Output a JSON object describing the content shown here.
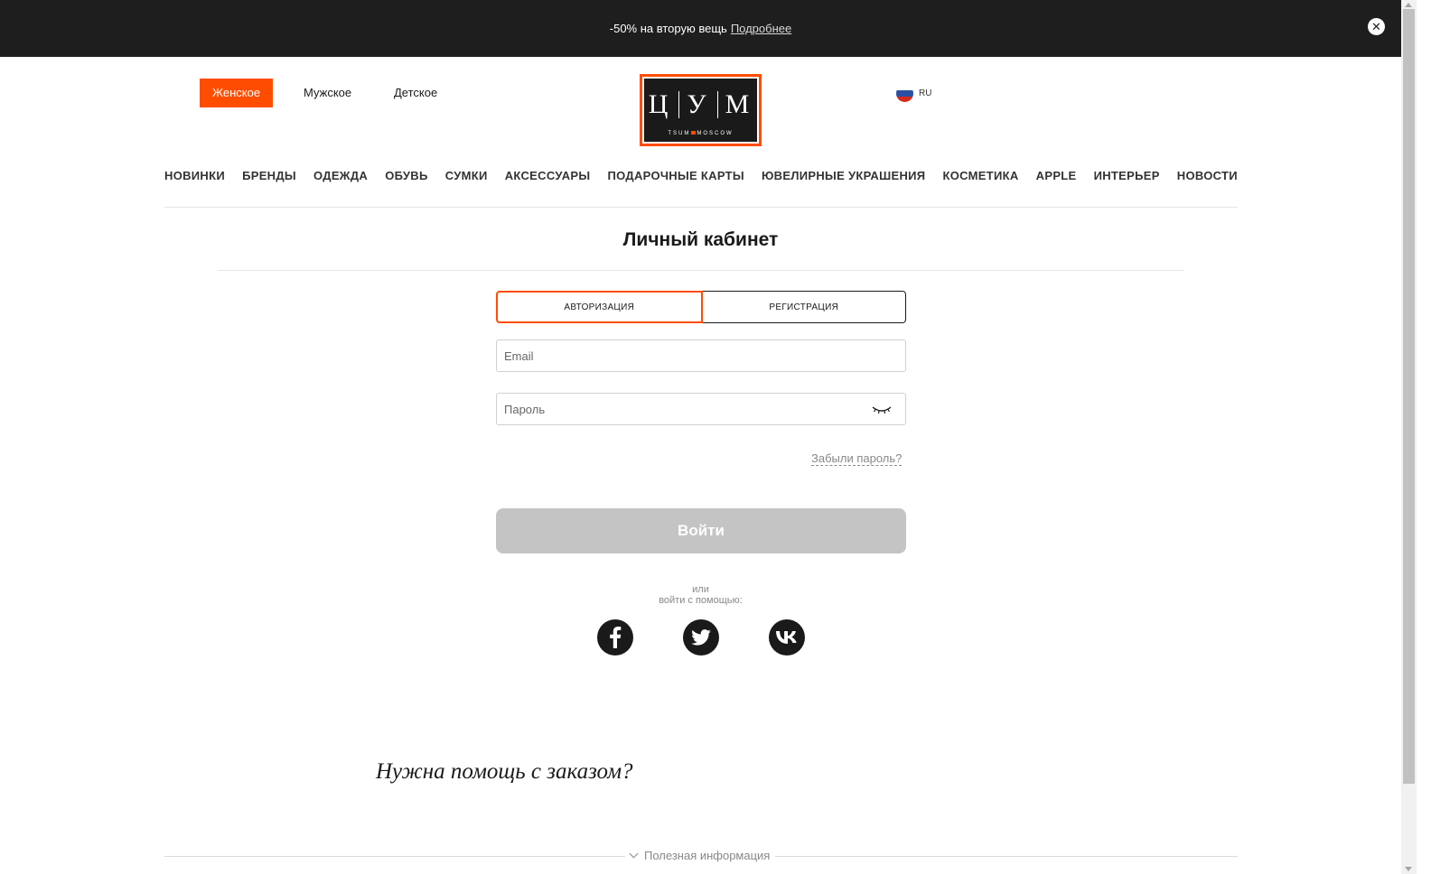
{
  "promo": {
    "text": "-50% на вторую вещь",
    "link": "Подробнее",
    "close_icon": "close-icon"
  },
  "gender": [
    {
      "label": "Женское",
      "active": true
    },
    {
      "label": "Мужское",
      "active": false
    },
    {
      "label": "Детское",
      "active": false
    }
  ],
  "logo": {
    "letter1": "Ц",
    "letter2": "У",
    "letter3": "М",
    "sub_left": "TSUM",
    "sub_right": "MOSCOW"
  },
  "lang": {
    "label": "RU",
    "flag_colors": [
      "#ffffff",
      "#2b4fa3",
      "#d52b1e"
    ]
  },
  "nav": [
    "НОВИНКИ",
    "БРЕНДЫ",
    "ОДЕЖДА",
    "ОБУВЬ",
    "СУМКИ",
    "АКСЕССУАРЫ",
    "ПОДАРОЧНЫЕ КАРТЫ",
    "ЮВЕЛИРНЫЕ УКРАШЕНИЯ",
    "КОСМЕТИКА",
    "APPLE",
    "ИНТЕРЬЕР",
    "НОВОСТИ"
  ],
  "page": {
    "title": "Личный кабинет"
  },
  "tabs": {
    "login": "АВТОРИЗАЦИЯ",
    "register": "РЕГИСТРАЦИЯ"
  },
  "form": {
    "email_placeholder": "Email",
    "password_placeholder": "Пароль",
    "forgot": "Забыли пароль?",
    "submit": "Войти",
    "or": "или",
    "or_social": "войти с помощью:"
  },
  "social": [
    "facebook-icon",
    "twitter-icon",
    "vk-icon"
  ],
  "help": {
    "title": "Нужна помощь с заказом?"
  },
  "footer": {
    "info": "Полезная информация"
  },
  "colors": {
    "accent": "#ff4d00",
    "promo_bg": "#1e1e1e",
    "button_disabled": "#c4c4c4"
  }
}
